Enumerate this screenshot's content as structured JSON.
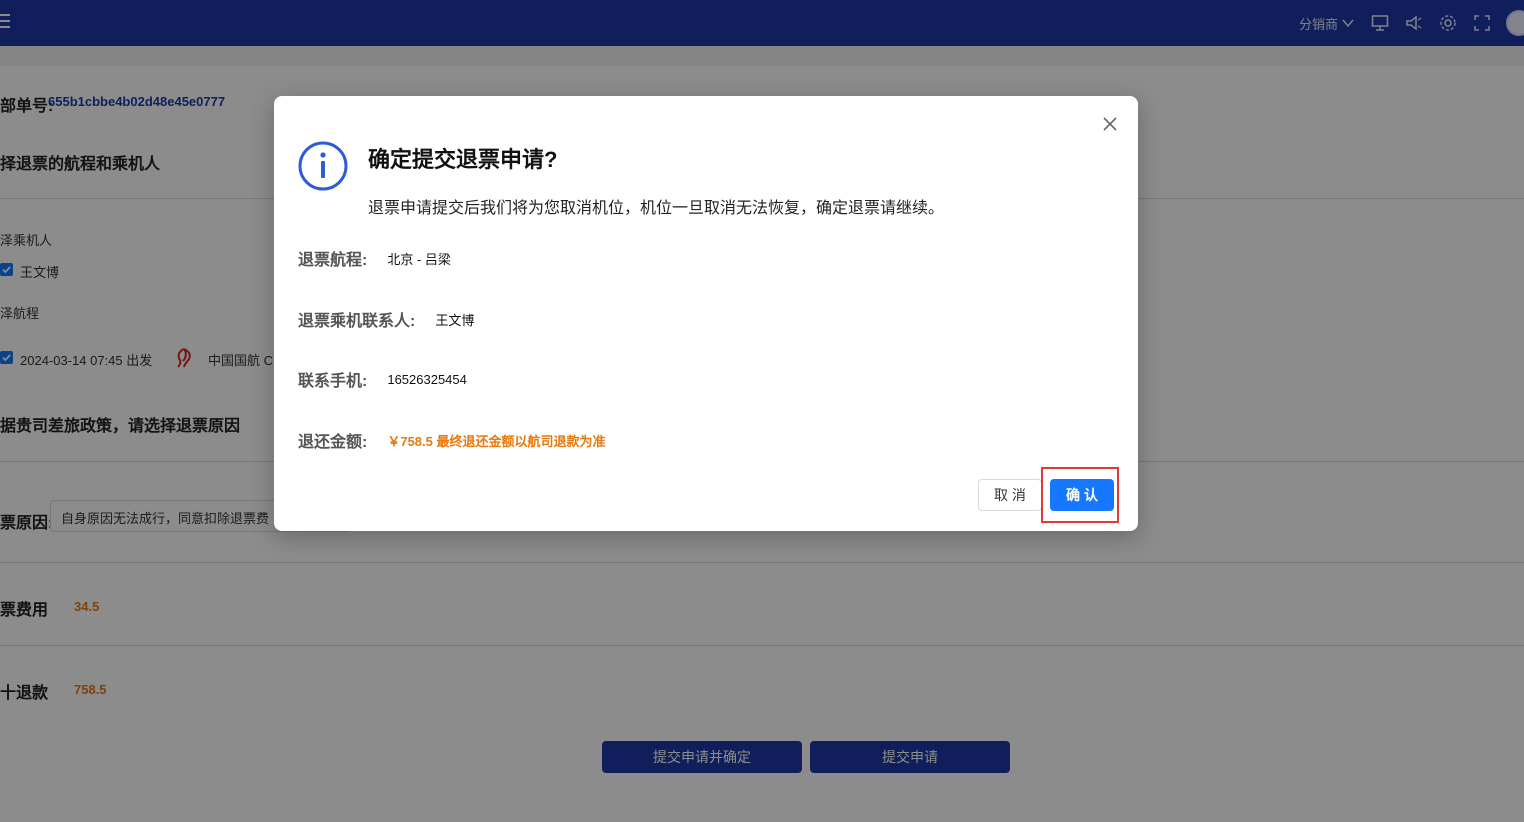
{
  "topbar": {
    "distributor_label": "分销商",
    "icons": [
      "monitor-icon",
      "speaker-icon",
      "gear-icon",
      "fullscreen-icon"
    ],
    "brand_color": "#1e3aa6"
  },
  "page": {
    "order_label": "部单号:",
    "order_number": "655b1cbbe4b02d48e45e0777",
    "section_select_title": "择退票的航程和乘机人",
    "passenger_label": "泽乘机人",
    "passenger_name": "王文博",
    "flight_label": "泽航程",
    "flight_datetime": "2024-03-14 07:45 出发",
    "airline": "中国国航 C",
    "policy_title": "据贵司差旅政策，请选择退票原因",
    "reason_label": "票原因:",
    "reason_value": "自身原因无法成行，同意扣除退票费",
    "fee_label": "票费用",
    "fee_value": "34.5",
    "refund_label": "十退款",
    "refund_value": "758.5",
    "submit_confirm_button": "提交申请并确定",
    "submit_button": "提交申请"
  },
  "modal": {
    "title": "确定提交退票申请?",
    "description": "退票申请提交后我们将为您取消机位，机位一旦取消无法恢复，确定退票请继续。",
    "fields": [
      {
        "label": "退票航程:",
        "value": "北京 - 吕梁"
      },
      {
        "label": "退票乘机联系人:",
        "value": "王文博"
      },
      {
        "label": "联系手机:",
        "value": "16526325454"
      },
      {
        "label": "退还金额:",
        "value": "￥758.5 最终退还金额以航司退款为准"
      }
    ],
    "cancel_button": "取 消",
    "ok_button": "确 认"
  },
  "colors": {
    "accent": "#1677ff",
    "amount": "#e8790c",
    "highlight": "#e53935"
  }
}
